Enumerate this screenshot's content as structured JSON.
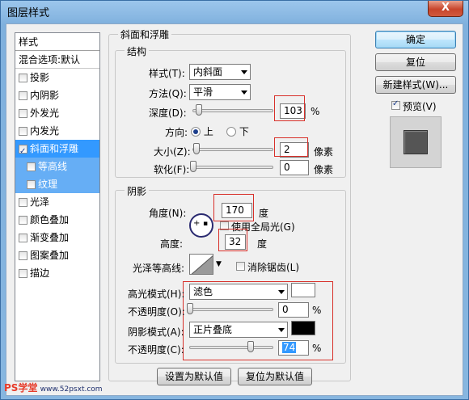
{
  "window": {
    "title": "图层样式",
    "close_label": "X"
  },
  "styles_list": {
    "header": "样式",
    "items": [
      {
        "label": "混合选项:默认",
        "checkbox": false,
        "checked": false
      },
      {
        "label": "投影",
        "checkbox": true,
        "checked": false
      },
      {
        "label": "内阴影",
        "checkbox": true,
        "checked": false
      },
      {
        "label": "外发光",
        "checkbox": true,
        "checked": false
      },
      {
        "label": "内发光",
        "checkbox": true,
        "checked": false
      },
      {
        "label": "斜面和浮雕",
        "checkbox": true,
        "checked": true,
        "selected": true
      },
      {
        "label": "等高线",
        "checkbox": true,
        "checked": false,
        "sub": true
      },
      {
        "label": "纹理",
        "checkbox": true,
        "checked": false,
        "sub": true
      },
      {
        "label": "光泽",
        "checkbox": true,
        "checked": false
      },
      {
        "label": "颜色叠加",
        "checkbox": true,
        "checked": false
      },
      {
        "label": "渐变叠加",
        "checkbox": true,
        "checked": false
      },
      {
        "label": "图案叠加",
        "checkbox": true,
        "checked": false
      },
      {
        "label": "描边",
        "checkbox": true,
        "checked": false
      }
    ]
  },
  "bevel": {
    "title": "斜面和浮雕",
    "structure": {
      "title": "结构",
      "style_label": "样式(T):",
      "style_value": "内斜面",
      "technique_label": "方法(Q):",
      "technique_value": "平滑",
      "depth_label": "深度(D):",
      "depth_value": "103",
      "depth_unit": "%",
      "depth_fraction": 0.1,
      "direction_label": "方向:",
      "direction_up": "上",
      "direction_down": "下",
      "direction_selected": "上",
      "size_label": "大小(Z):",
      "size_value": "2",
      "size_unit": "像素",
      "soften_label": "软化(F):",
      "soften_value": "0",
      "soften_unit": "像素"
    },
    "shading": {
      "title": "阴影",
      "angle_label": "角度(N):",
      "angle_value": "170",
      "angle_unit": "度",
      "global_light_label": "使用全局光(G)",
      "global_light_checked": false,
      "altitude_label": "高度:",
      "altitude_value": "32",
      "altitude_unit": "度",
      "gloss_label": "光泽等高线:",
      "antialias_label": "消除锯齿(L)",
      "antialias_checked": false,
      "highlight_mode_label": "高光模式(H):",
      "highlight_mode_value": "滤色",
      "highlight_color": "#ffffff",
      "highlight_opacity_label": "不透明度(O):",
      "highlight_opacity_value": "0",
      "highlight_opacity_unit": "%",
      "shadow_mode_label": "阴影模式(A):",
      "shadow_mode_value": "正片叠底",
      "shadow_color": "#000000",
      "shadow_opacity_label": "不透明度(C):",
      "shadow_opacity_value": "74",
      "shadow_opacity_unit": "%"
    },
    "make_default_label": "设置为默认值",
    "reset_default_label": "复位为默认值"
  },
  "buttons": {
    "ok": "确定",
    "reset": "复位",
    "new_style": "新建样式(W)...",
    "preview_label": "预览(V)",
    "preview_checked": true
  },
  "watermark": {
    "brand": "PS学堂",
    "url": "www.52psxt.com"
  }
}
